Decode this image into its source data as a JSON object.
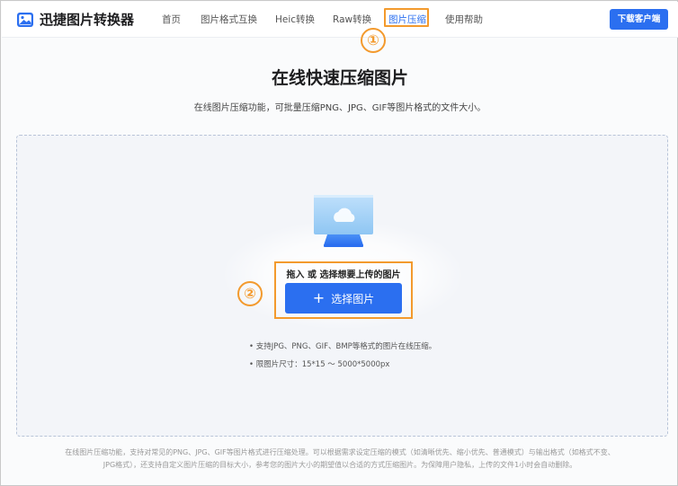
{
  "header": {
    "logo_text": "迅捷图片转换器",
    "nav": [
      {
        "label": "首页"
      },
      {
        "label": "图片格式互换"
      },
      {
        "label": "Heic转换"
      },
      {
        "label": "Raw转换"
      },
      {
        "label": "图片压缩",
        "active": true
      },
      {
        "label": "使用帮助"
      }
    ],
    "download_label": "下载客户端"
  },
  "annotations": {
    "step1": "①",
    "step2": "②"
  },
  "main": {
    "title": "在线快速压缩图片",
    "subtitle": "在线图片压缩功能，可批量压缩PNG、JPG、GIF等图片格式的文件大小。",
    "upload": {
      "drag_text": "拖入 或 选择想要上传的图片",
      "select_label": "选择图片",
      "notes": [
        "• 支持JPG、PNG、GIF、BMP等格式的图片在线压缩。",
        "• 限图片尺寸：15*15 ～ 5000*5000px"
      ]
    }
  },
  "footer": {
    "line1": "在线图片压缩功能，支持对常见的PNG、JPG、GIF等图片格式进行压缩处理。可以根据需求设定压缩的模式（如清晰优先、缩小优先、普通模式）与输出格式（如格式不变、",
    "line2": "JPG格式），还支持自定义图片压缩的目标大小，参考您的图片大小的期望值以合适的方式压缩图片。为保障用户隐私，上传的文件1小时会自动删除。"
  },
  "colors": {
    "accent": "#2b6ff0",
    "highlight": "#f39a2d"
  }
}
